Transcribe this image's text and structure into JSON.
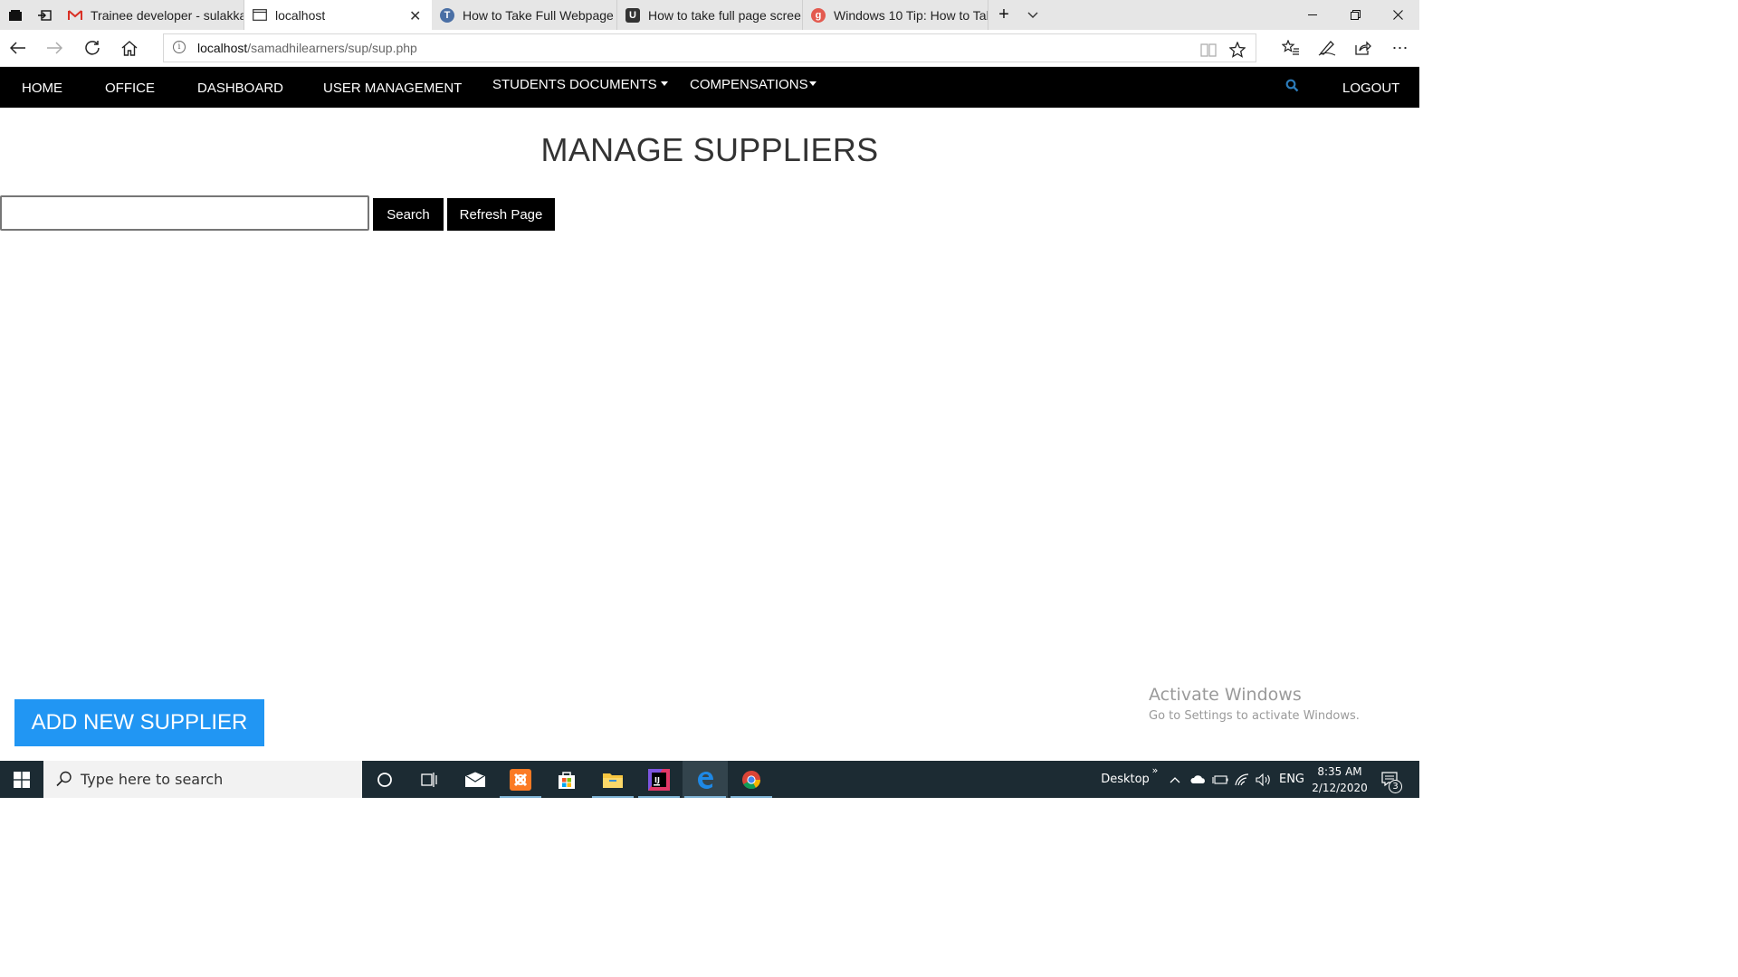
{
  "browser": {
    "tabs": [
      {
        "title": "Trainee developer - sulakkaı",
        "icon": "gmail-icon"
      },
      {
        "title": "localhost",
        "icon": "page-icon",
        "active": true
      },
      {
        "title": "How to Take Full Webpage :",
        "icon": "site-icon"
      },
      {
        "title": "How to take full page screeı",
        "icon": "site-icon"
      },
      {
        "title": "Windows 10 Tip: How to Tal",
        "icon": "site-icon"
      }
    ],
    "url_host": "localhost",
    "url_path": "/samadhilearners/sup/sup.php"
  },
  "navbar": {
    "home": "HOME",
    "office": "OFFICE",
    "dashboard": "DASHBOARD",
    "user_management": "USER MANAGEMENT",
    "students_documents": "STUDENTS DOCUMENTS",
    "compensations": "COMPENSATIONS",
    "logout": "LOGOUT"
  },
  "main": {
    "title": "MANAGE SUPPLIERS",
    "search_value": "",
    "search_button": "Search",
    "refresh_button": "Refresh Page",
    "add_button": "ADD NEW SUPPLIER"
  },
  "watermark": {
    "line1": "Activate Windows",
    "line2": "Go to Settings to activate Windows."
  },
  "taskbar": {
    "search_placeholder": "Type here to search",
    "desktop_label": "Desktop",
    "lang": "ENG",
    "time": "8:35 AM",
    "date": "2/12/2020",
    "notification_count": "3"
  },
  "colors": {
    "navbar_bg": "#000000",
    "add_button_bg": "#2196f3",
    "search_icon": "#2b7bb9",
    "taskbar_bg": "#1c2b33"
  }
}
